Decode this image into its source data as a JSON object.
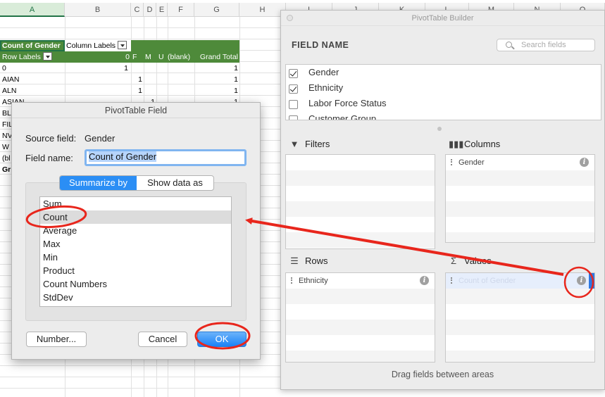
{
  "sheet": {
    "columns": [
      "A",
      "B",
      "C",
      "D",
      "E",
      "F",
      "G",
      "H",
      "I",
      "J",
      "K",
      "L",
      "M",
      "N",
      "O"
    ],
    "pivot": {
      "header1": [
        "Count of Gender",
        "Column Labels"
      ],
      "header2": [
        "Row Labels",
        "0",
        "F",
        "M",
        "U",
        "(blank)",
        "Grand Total"
      ],
      "rows": [
        {
          "label": "0",
          "b": "1",
          "c": "",
          "e": "",
          "g": "1"
        },
        {
          "label": "AIAN",
          "b": "",
          "c": "1",
          "e": "",
          "g": "1"
        },
        {
          "label": "ALN",
          "b": "",
          "c": "1",
          "e": "",
          "g": "1"
        },
        {
          "label": "ASIAN",
          "b": "",
          "c": "",
          "e": "1",
          "g": "1"
        },
        {
          "label": "BL",
          "b": "",
          "c": "",
          "e": "",
          "g": ""
        },
        {
          "label": "FIL",
          "b": "",
          "c": "",
          "e": "",
          "g": ""
        },
        {
          "label": "NV",
          "b": "",
          "c": "",
          "e": "",
          "g": ""
        },
        {
          "label": "W",
          "b": "",
          "c": "",
          "e": "",
          "g": ""
        },
        {
          "label": "(bl",
          "b": "",
          "c": "",
          "e": "",
          "g": ""
        },
        {
          "label": "Gr",
          "b": "",
          "c": "",
          "e": "",
          "g": ""
        }
      ]
    }
  },
  "builder": {
    "title": "PivotTable Builder",
    "field_name_header": "FIELD NAME",
    "search_placeholder": "Search fields",
    "fields": [
      {
        "label": "Gender",
        "checked": true
      },
      {
        "label": "Ethnicity",
        "checked": true
      },
      {
        "label": "Labor Force Status",
        "checked": false
      },
      {
        "label": "Customer Group",
        "checked": false
      }
    ],
    "areas": {
      "filters": {
        "label": "Filters",
        "items": []
      },
      "columns": {
        "label": "Columns",
        "items": [
          "Gender"
        ]
      },
      "rows": {
        "label": "Rows",
        "items": [
          "Ethnicity"
        ]
      },
      "values": {
        "label": "Values",
        "items": [
          "Count of Gender"
        ]
      }
    },
    "drag_hint": "Drag fields between areas"
  },
  "dialog": {
    "title": "PivotTable Field",
    "source_label": "Source field:",
    "source_value": "Gender",
    "name_label": "Field name:",
    "name_value": "Count of Gender",
    "tabs": [
      "Summarize by",
      "Show data as"
    ],
    "functions": [
      "Sum",
      "Count",
      "Average",
      "Max",
      "Min",
      "Product",
      "Count Numbers",
      "StdDev"
    ],
    "selected_function": "Count",
    "buttons": {
      "number": "Number...",
      "cancel": "Cancel",
      "ok": "OK"
    }
  },
  "annotation_color": "#e8261c"
}
